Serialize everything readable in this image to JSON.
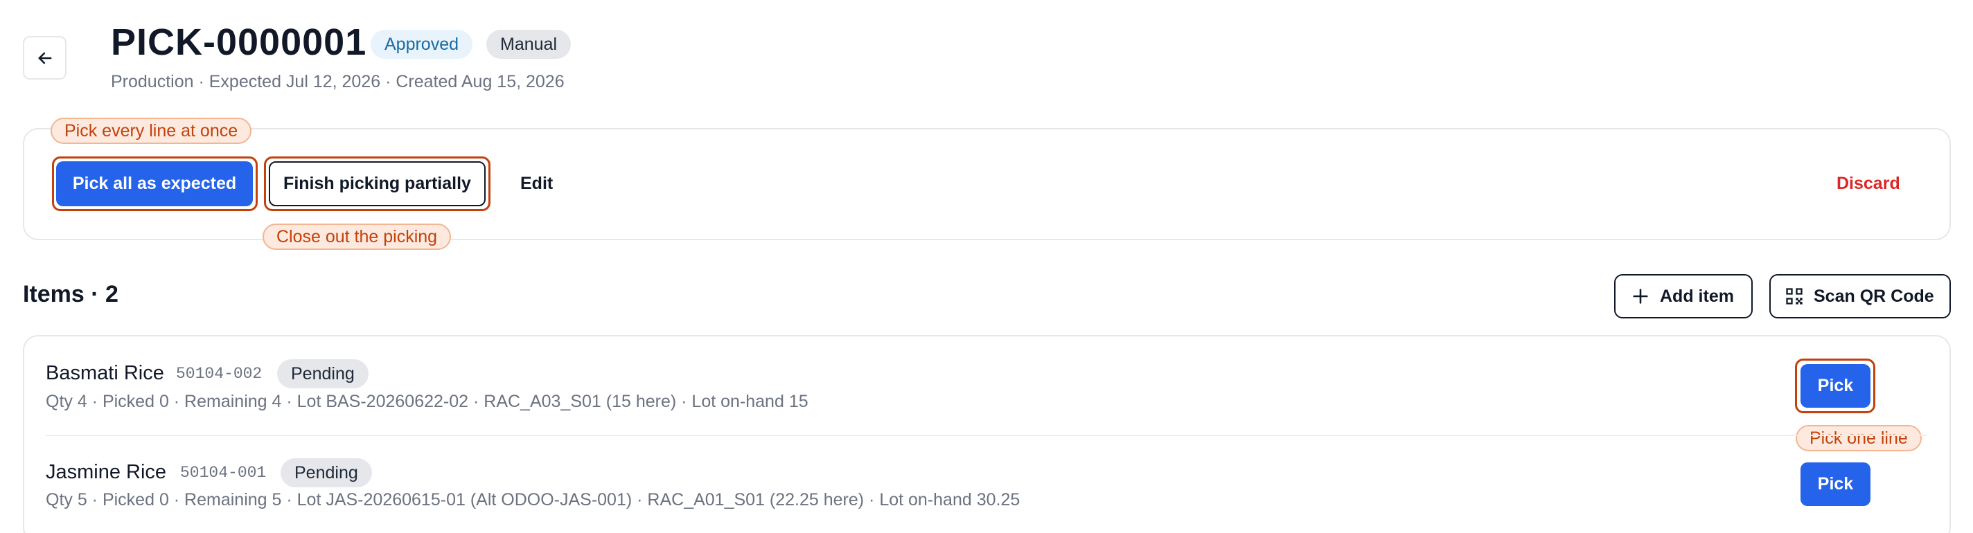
{
  "header": {
    "title": "PICK-0000001",
    "status_badge": "Approved",
    "type_badge": "Manual",
    "subtitle": "Production · Expected Jul 12, 2026 · Created Aug 15, 2026"
  },
  "actions": {
    "pick_all_label": "Pick all as expected",
    "finish_partial_label": "Finish picking partially",
    "edit_label": "Edit",
    "discard_label": "Discard",
    "tips": {
      "pick_all": "Pick every line at once",
      "finish_partial": "Close out the picking",
      "pick_one": "Pick one line"
    }
  },
  "items_section": {
    "title": "Items · 2",
    "add_item_label": "Add item",
    "scan_qr_label": "Scan QR Code"
  },
  "items": [
    {
      "name": "Basmati Rice",
      "sku": "50104-002",
      "status": "Pending",
      "meta": "Qty 4 · Picked 0 · Remaining 4 · Lot BAS-20260622-02 · RAC_A03_S01 (15 here) · Lot on-hand 15",
      "action_label": "Pick"
    },
    {
      "name": "Jasmine Rice",
      "sku": "50104-001",
      "status": "Pending",
      "meta": "Qty 5 · Picked 0 · Remaining 5 · Lot JAS-20260615-01 (Alt ODOO-JAS-001) · RAC_A01_S01 (22.25 here) · Lot on-hand 30.25",
      "action_label": "Pick"
    }
  ],
  "colors": {
    "primary": "#2563eb",
    "danger": "#dc2626",
    "highlight": "#c2410c",
    "tip_background": "#fde9dd",
    "approved_text": "#1a6aa0",
    "approved_background": "#e8f3fb"
  },
  "icons": {
    "back": "arrow-left-icon",
    "add": "plus-icon",
    "scan": "qr-code-icon"
  }
}
